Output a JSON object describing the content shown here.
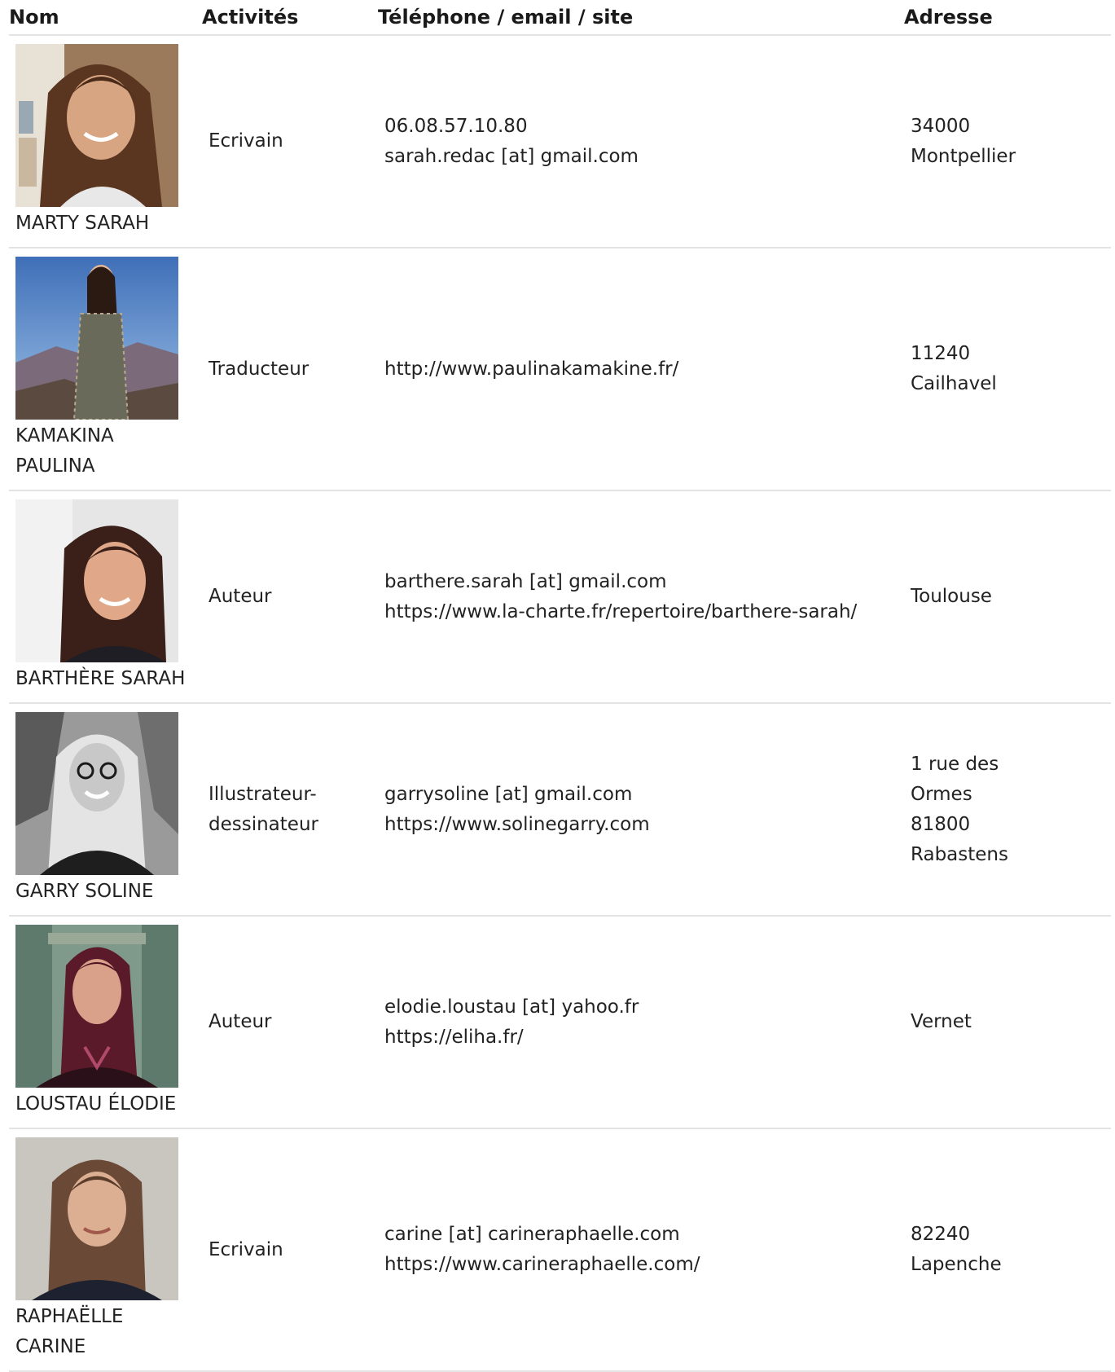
{
  "table": {
    "headers": {
      "name": "Nom",
      "activities": "Activités",
      "contact": "Téléphone / email / site",
      "address": "Adresse"
    },
    "rows": [
      {
        "name": "MARTY SARAH",
        "activity_lines": [
          "Ecrivain"
        ],
        "contact_lines": [
          "06.08.57.10.80",
          "sarah.redac [at] gmail.com"
        ],
        "address_lines": [
          "34000",
          "Montpellier"
        ]
      },
      {
        "name": "KAMAKINA PAULINA",
        "activity_lines": [
          "Traducteur"
        ],
        "contact_lines": [
          "http://www.paulinakamakine.fr/"
        ],
        "address_lines": [
          "11240",
          "Cailhavel"
        ]
      },
      {
        "name": "BARTHÈRE SARAH",
        "activity_lines": [
          "Auteur"
        ],
        "contact_lines": [
          "barthere.sarah [at] gmail.com",
          "https://www.la-charte.fr/repertoire/barthere-sarah/"
        ],
        "address_lines": [
          "Toulouse"
        ]
      },
      {
        "name": "GARRY SOLINE",
        "activity_lines": [
          "Illustrateur-",
          "dessinateur"
        ],
        "contact_lines": [
          "garrysoline [at] gmail.com",
          "https://www.solinegarry.com"
        ],
        "address_lines": [
          "1 rue des",
          "Ormes",
          "81800",
          "Rabastens"
        ]
      },
      {
        "name": "LOUSTAU ÉLODIE",
        "activity_lines": [
          "Auteur"
        ],
        "contact_lines": [
          "elodie.loustau [at] yahoo.fr",
          "https://eliha.fr/"
        ],
        "address_lines": [
          "Vernet"
        ]
      },
      {
        "name": "RAPHAËLLE CARINE",
        "activity_lines": [
          "Ecrivain"
        ],
        "contact_lines": [
          "carine [at] carineraphaelle.com",
          "https://www.carineraphaelle.com/"
        ],
        "address_lines": [
          "82240",
          "Lapenche"
        ]
      }
    ]
  },
  "colors": {
    "text": "#222222",
    "header_text": "#1a1a1a",
    "row_divider": "#e3e3e3",
    "background": "#ffffff"
  }
}
